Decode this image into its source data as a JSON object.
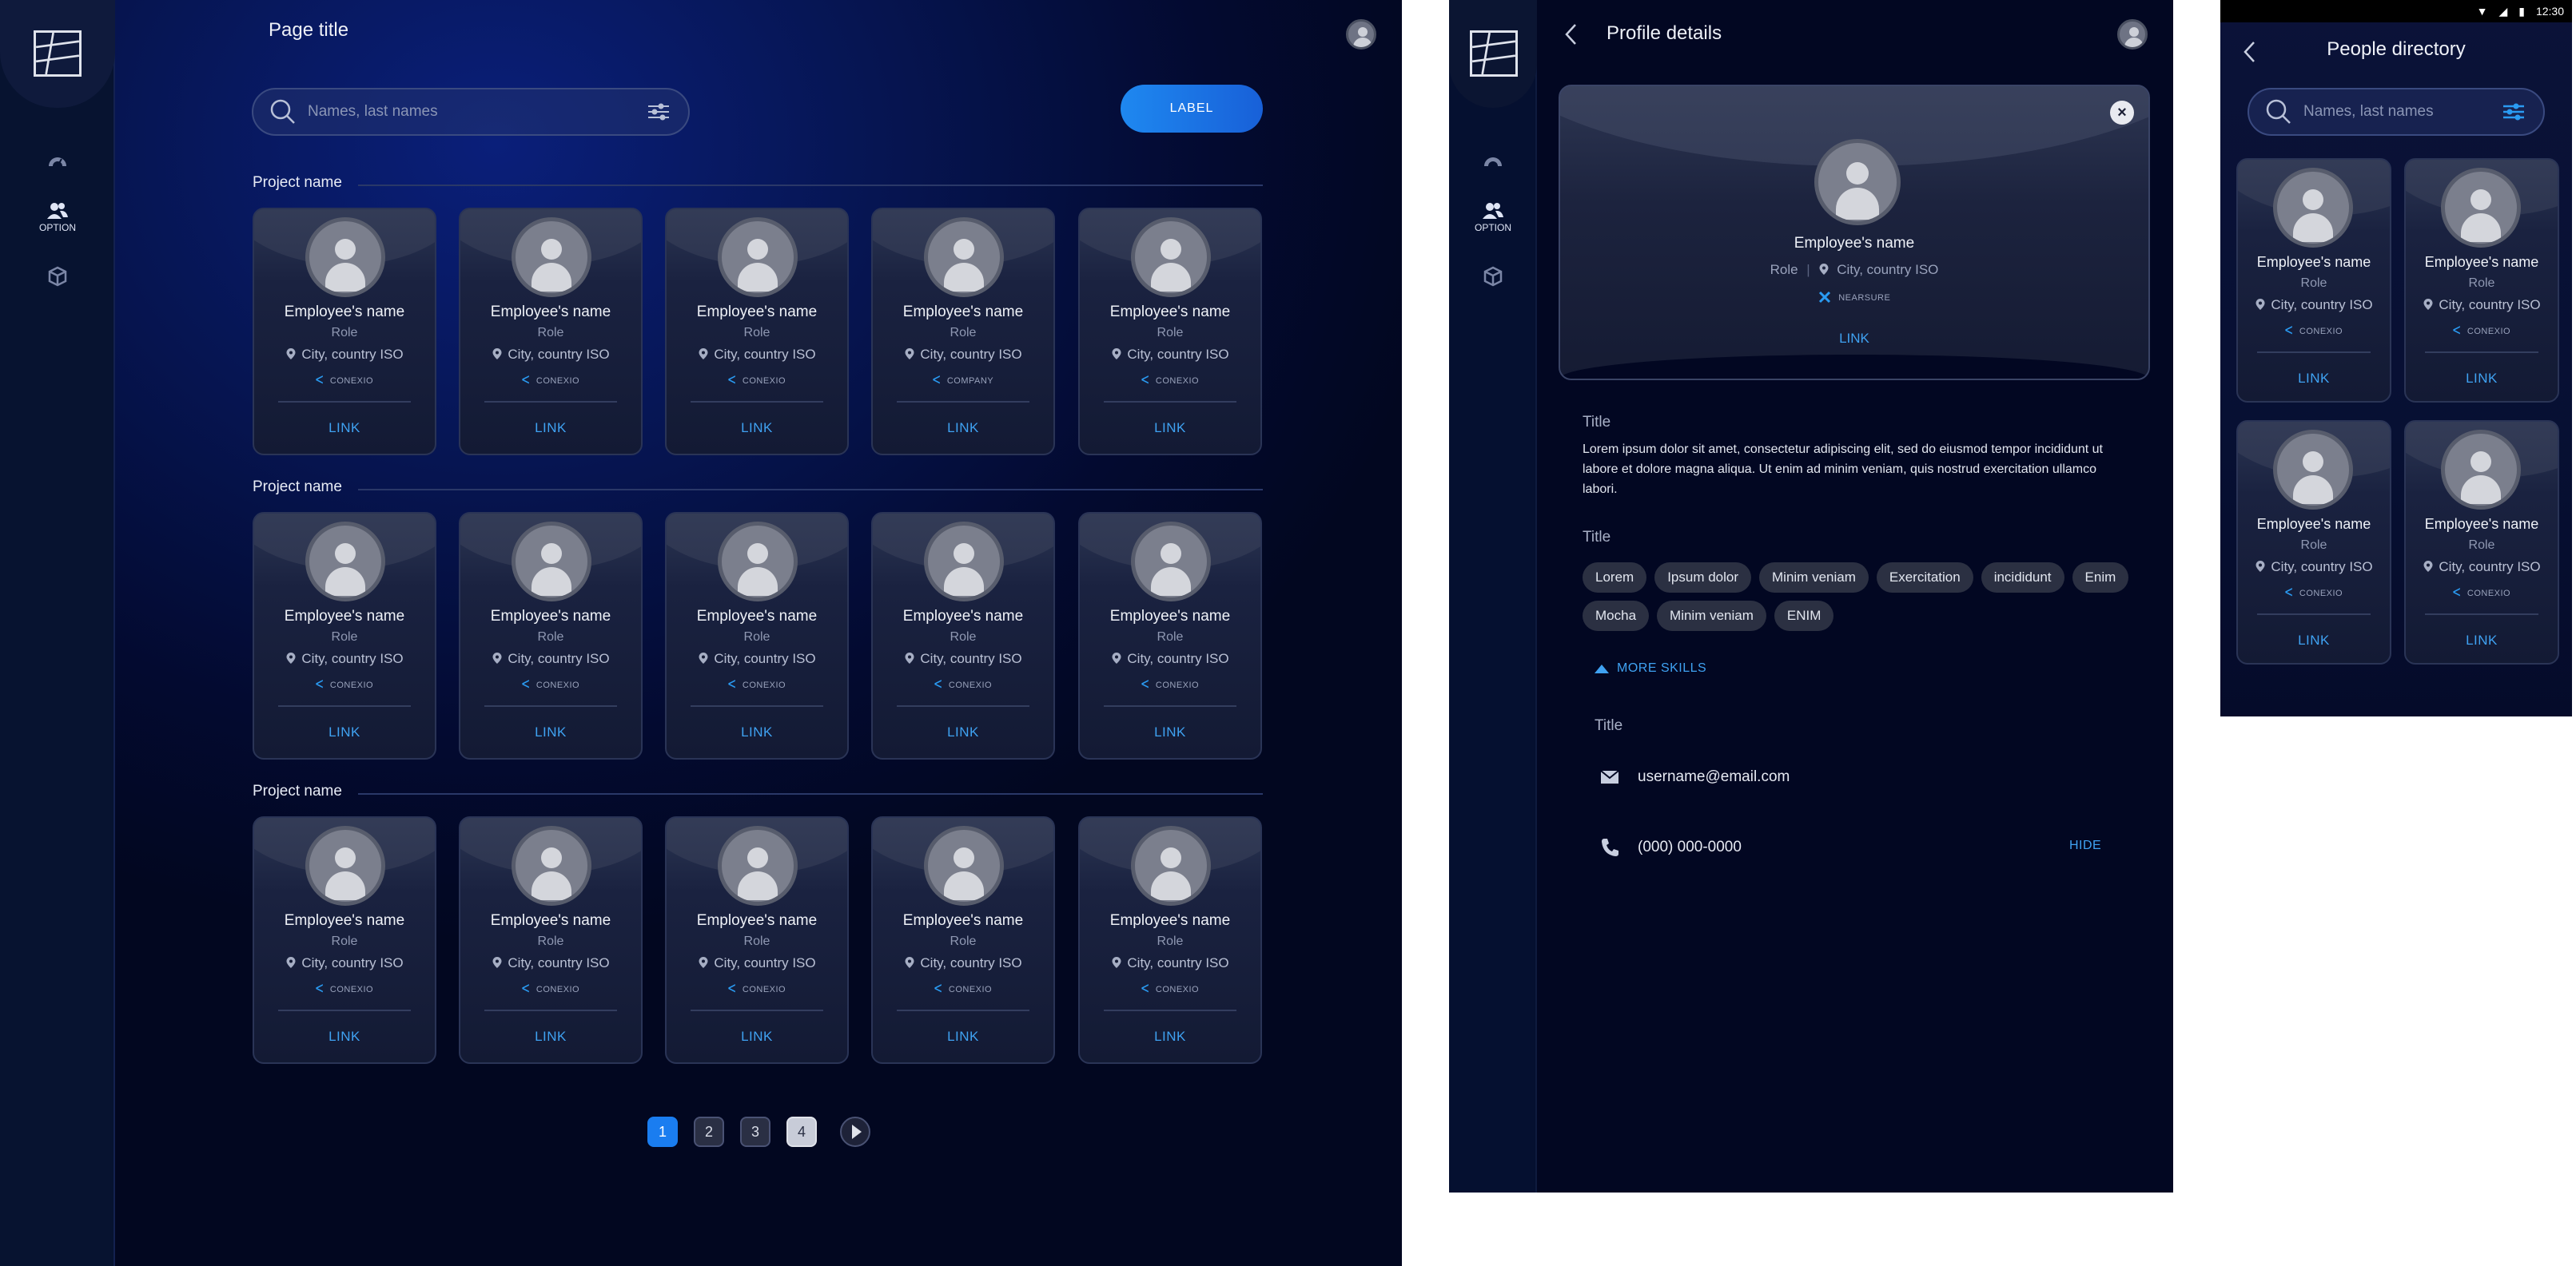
{
  "desktop": {
    "page_title": "Page title",
    "nav": [
      {
        "icon": "dashboard-icon",
        "label": ""
      },
      {
        "icon": "people-icon",
        "label": "OPTION"
      },
      {
        "icon": "cube-icon",
        "label": ""
      }
    ],
    "search": {
      "placeholder": "Names, last names"
    },
    "label_button": "LABEL",
    "sections": [
      {
        "title": "Project name",
        "cards": [
          {
            "name": "Employee's name",
            "role": "Role",
            "location": "City, country ISO",
            "company": "CONEXIO",
            "link": "LINK"
          },
          {
            "name": "Employee's name",
            "role": "Role",
            "location": "City, country ISO",
            "company": "CONEXIO",
            "link": "LINK"
          },
          {
            "name": "Employee's name",
            "role": "Role",
            "location": "City, country ISO",
            "company": "CONEXIO",
            "link": "LINK"
          },
          {
            "name": "Employee's name",
            "role": "Role",
            "location": "City, country ISO",
            "company": "COMPANY",
            "link": "LINK"
          },
          {
            "name": "Employee's name",
            "role": "Role",
            "location": "City, country ISO",
            "company": "CONEXIO",
            "link": "LINK"
          }
        ]
      },
      {
        "title": "Project name",
        "cards": [
          {
            "name": "Employee's name",
            "role": "Role",
            "location": "City, country ISO",
            "company": "CONEXIO",
            "link": "LINK"
          },
          {
            "name": "Employee's name",
            "role": "Role",
            "location": "City, country ISO",
            "company": "CONEXIO",
            "link": "LINK"
          },
          {
            "name": "Employee's name",
            "role": "Role",
            "location": "City, country ISO",
            "company": "CONEXIO",
            "link": "LINK"
          },
          {
            "name": "Employee's name",
            "role": "Role",
            "location": "City, country ISO",
            "company": "CONEXIO",
            "link": "LINK"
          },
          {
            "name": "Employee's name",
            "role": "Role",
            "location": "City, country ISO",
            "company": "CONEXIO",
            "link": "LINK"
          }
        ]
      },
      {
        "title": "Project name",
        "cards": [
          {
            "name": "Employee's name",
            "role": "Role",
            "location": "City, country ISO",
            "company": "CONEXIO",
            "link": "LINK"
          },
          {
            "name": "Employee's name",
            "role": "Role",
            "location": "City, country ISO",
            "company": "CONEXIO",
            "link": "LINK"
          },
          {
            "name": "Employee's name",
            "role": "Role",
            "location": "City, country ISO",
            "company": "CONEXIO",
            "link": "LINK"
          },
          {
            "name": "Employee's name",
            "role": "Role",
            "location": "City, country ISO",
            "company": "CONEXIO",
            "link": "LINK"
          },
          {
            "name": "Employee's name",
            "role": "Role",
            "location": "City, country ISO",
            "company": "CONEXIO",
            "link": "LINK"
          }
        ]
      }
    ],
    "pagination": {
      "pages": [
        "1",
        "2",
        "3",
        "4"
      ],
      "current": "1"
    }
  },
  "profile": {
    "title": "Profile details",
    "nav_option_label": "OPTION",
    "card": {
      "name": "Employee's name",
      "role": "Role",
      "location": "City, country ISO",
      "company": "NEARSURE",
      "link": "LINK",
      "close_icon": "close-icon"
    },
    "about": {
      "title": "Title",
      "text": "Lorem ipsum dolor sit amet, consectetur adipiscing elit, sed do eiusmod tempor incididunt ut labore et dolore magna aliqua. Ut enim ad minim veniam, quis nostrud exercitation ullamco labori."
    },
    "skills": {
      "title": "Title",
      "chips": [
        "Lorem",
        "Ipsum dolor",
        "Minim veniam",
        "Exercitation",
        "incididunt",
        "Enim",
        "Mocha",
        "Minim veniam",
        "ENIM"
      ],
      "more_label": "MORE SKILLS"
    },
    "contact": {
      "title": "Title",
      "email": "username@email.com",
      "phone": "(000) 000-0000",
      "hide_label": "HIDE"
    }
  },
  "mobile": {
    "status_time": "12:30",
    "title": "People directory",
    "search": {
      "placeholder": "Names, last names"
    },
    "cards": [
      {
        "name": "Employee's name",
        "role": "Role",
        "location": "City, country ISO",
        "company": "CONEXIO",
        "link": "LINK"
      },
      {
        "name": "Employee's name",
        "role": "Role",
        "location": "City, country ISO",
        "company": "CONEXIO",
        "link": "LINK"
      },
      {
        "name": "Employee's name",
        "role": "Role",
        "location": "City, country ISO",
        "company": "CONEXIO",
        "link": "LINK"
      },
      {
        "name": "Employee's name",
        "role": "Role",
        "location": "City, country ISO",
        "company": "CONEXIO",
        "link": "LINK"
      }
    ]
  },
  "colors": {
    "accent": "#1a7df0",
    "link": "#3fa2f2",
    "background": "#061552"
  }
}
